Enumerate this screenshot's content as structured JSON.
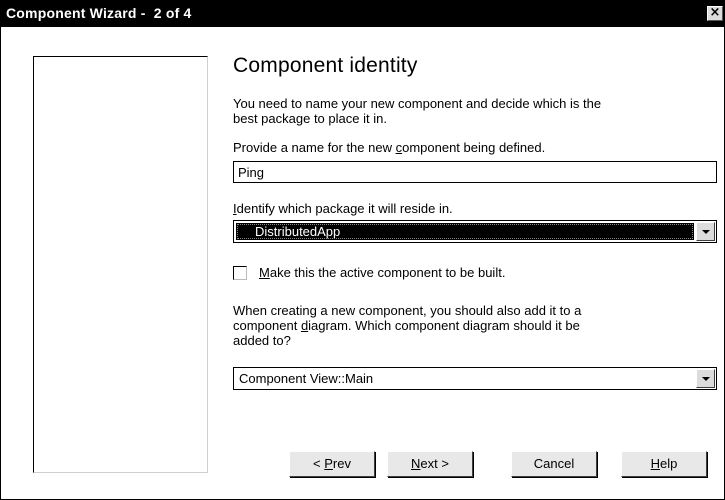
{
  "window": {
    "title": "Component Wizard -  2 of 4",
    "close_glyph": "×"
  },
  "page": {
    "heading": "Component identity",
    "intro_line1": "You need to name your new component and decide which is the",
    "intro_line2": "best package to place it in.",
    "name_label_pre": "Provide a name for the new ",
    "name_label_accel": "c",
    "name_label_post": "omponent being defined.",
    "name_value": "Ping",
    "package_label_accel": "I",
    "package_label_post": "dentify which package it will reside in.",
    "package_selected": "DistributedApp",
    "checkbox_accel": "M",
    "checkbox_label_post": "ake this the active component to be built.",
    "checkbox_checked": false,
    "diagram_line1": "When creating a new component, you should also add it to a",
    "diagram_line2_pre": "component ",
    "diagram_line2_accel": "d",
    "diagram_line2_post": "iagram. Which component diagram should it be",
    "diagram_line3": "added to?",
    "diagram_selected": "Component View::Main"
  },
  "buttons": {
    "prev_pre": "< ",
    "prev_accel": "P",
    "prev_post": "rev",
    "next_accel": "N",
    "next_post": "ext >",
    "cancel": "Cancel",
    "help_accel": "H",
    "help_post": "elp"
  }
}
